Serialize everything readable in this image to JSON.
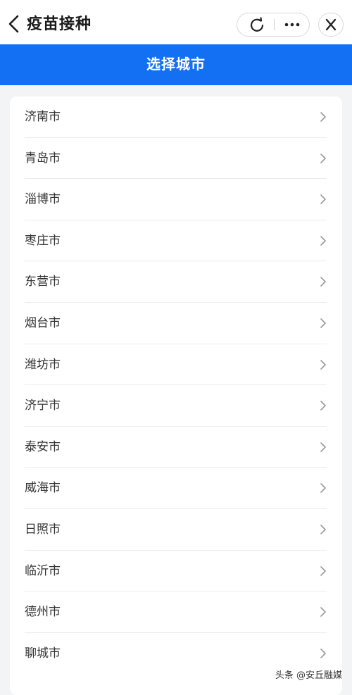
{
  "topbar": {
    "title": "疫苗接种"
  },
  "header": {
    "title": "选择城市"
  },
  "cities": [
    "济南市",
    "青岛市",
    "淄博市",
    "枣庄市",
    "东营市",
    "烟台市",
    "潍坊市",
    "济宁市",
    "泰安市",
    "威海市",
    "日照市",
    "临沂市",
    "德州市",
    "聊城市"
  ],
  "watermark": "头条 @安丘融媒",
  "colors": {
    "brand_blue": "#1370f2",
    "background": "#f3f4f6"
  },
  "icons": {
    "back": "chevron-left-icon",
    "refresh": "refresh-icon",
    "more": "more-dots-icon",
    "close": "close-icon",
    "row": "chevron-right-icon"
  }
}
